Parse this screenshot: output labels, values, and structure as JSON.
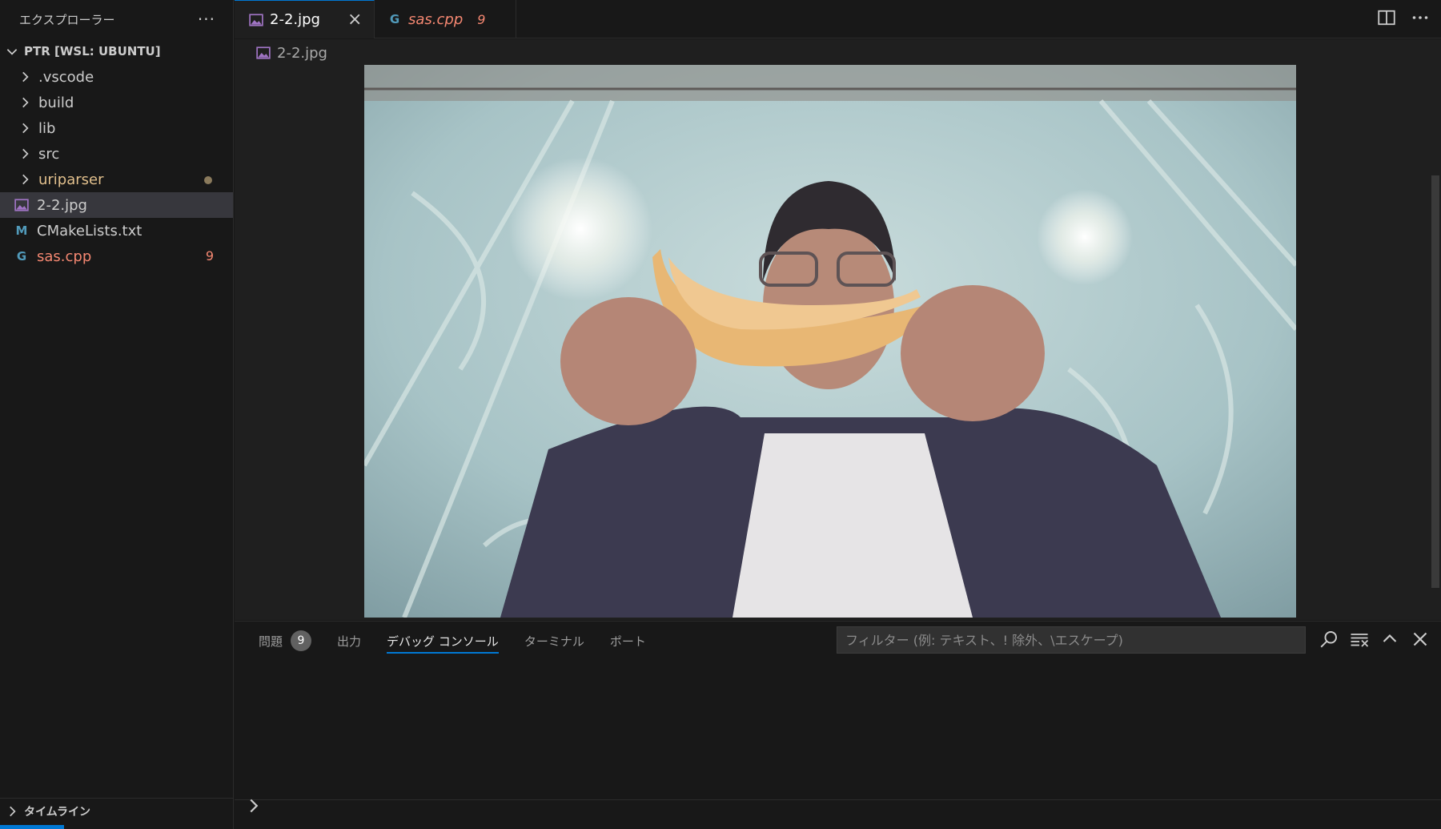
{
  "sidebar": {
    "title": "エクスプローラー",
    "more": "···",
    "root": "PTR [WSL: UBUNTU]",
    "folders": [
      {
        "label": ".vscode"
      },
      {
        "label": "build"
      },
      {
        "label": "lib"
      },
      {
        "label": "src"
      },
      {
        "label": "uriparser"
      }
    ],
    "files": [
      {
        "label": "2-2.jpg",
        "icon": "image-file-icon"
      },
      {
        "label": "CMakeLists.txt",
        "icon": "cmake-m-icon",
        "icon_text": "M"
      },
      {
        "label": "sas.cpp",
        "icon": "cpp-file-icon",
        "icon_text": "G",
        "count": "9"
      }
    ],
    "timeline": "タイムライン"
  },
  "tabs": [
    {
      "label": "2-2.jpg",
      "close": "×"
    },
    {
      "label": "sas.cpp",
      "errors": "9"
    }
  ],
  "breadcrumb": "2-2.jpg",
  "panel": {
    "tabs": [
      {
        "label": "問題",
        "badge": "9"
      },
      {
        "label": "出力"
      },
      {
        "label": "デバッグ コンソール"
      },
      {
        "label": "ターミナル"
      },
      {
        "label": "ポート"
      }
    ],
    "filter_placeholder": "フィルター (例: テキスト、! 除外、\\エスケープ)"
  },
  "colors": {
    "accent": "#0078d4",
    "error": "#f48771",
    "modified_folder": "#e2c08d",
    "image_icon": "#a074c4",
    "cmake_icon": "#519aba",
    "cpp_icon": "#519aba"
  }
}
